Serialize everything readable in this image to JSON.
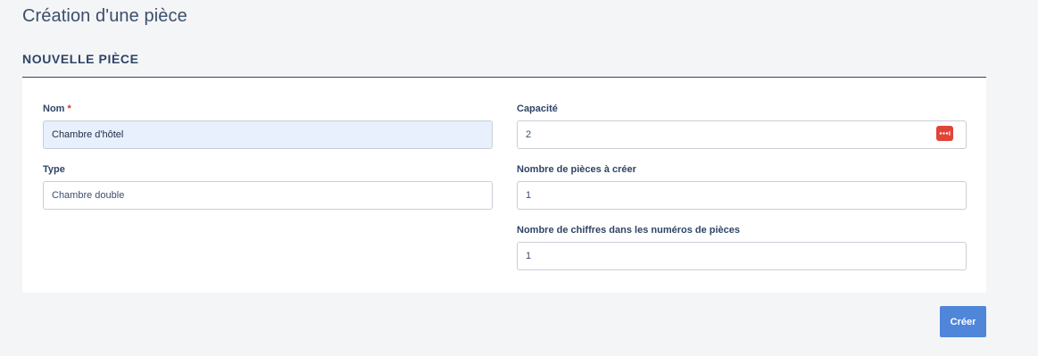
{
  "page": {
    "title": "Création d'une pièce"
  },
  "section": {
    "title": "NOUVELLE PIÈCE"
  },
  "form": {
    "name": {
      "label": "Nom",
      "required_marker": "*",
      "value": "Chambre d'hôtel"
    },
    "type": {
      "label": "Type",
      "value": "Chambre double"
    },
    "capacity": {
      "label": "Capacité",
      "value": "2",
      "stepper_icon": "dots-icon"
    },
    "rooms_to_create": {
      "label": "Nombre de pièces à créer",
      "value": "1"
    },
    "room_number_digits": {
      "label": "Nombre de chiffres dans les numéros de pièces",
      "value": "1"
    }
  },
  "actions": {
    "create_label": "Créer"
  },
  "colors": {
    "background": "#f4f5f7",
    "card": "#ffffff",
    "heading": "#2f4565",
    "required": "#d13438",
    "filled_input": "#e8f0fe",
    "stepper": "#e0453a",
    "primary": "#4f86d9"
  }
}
